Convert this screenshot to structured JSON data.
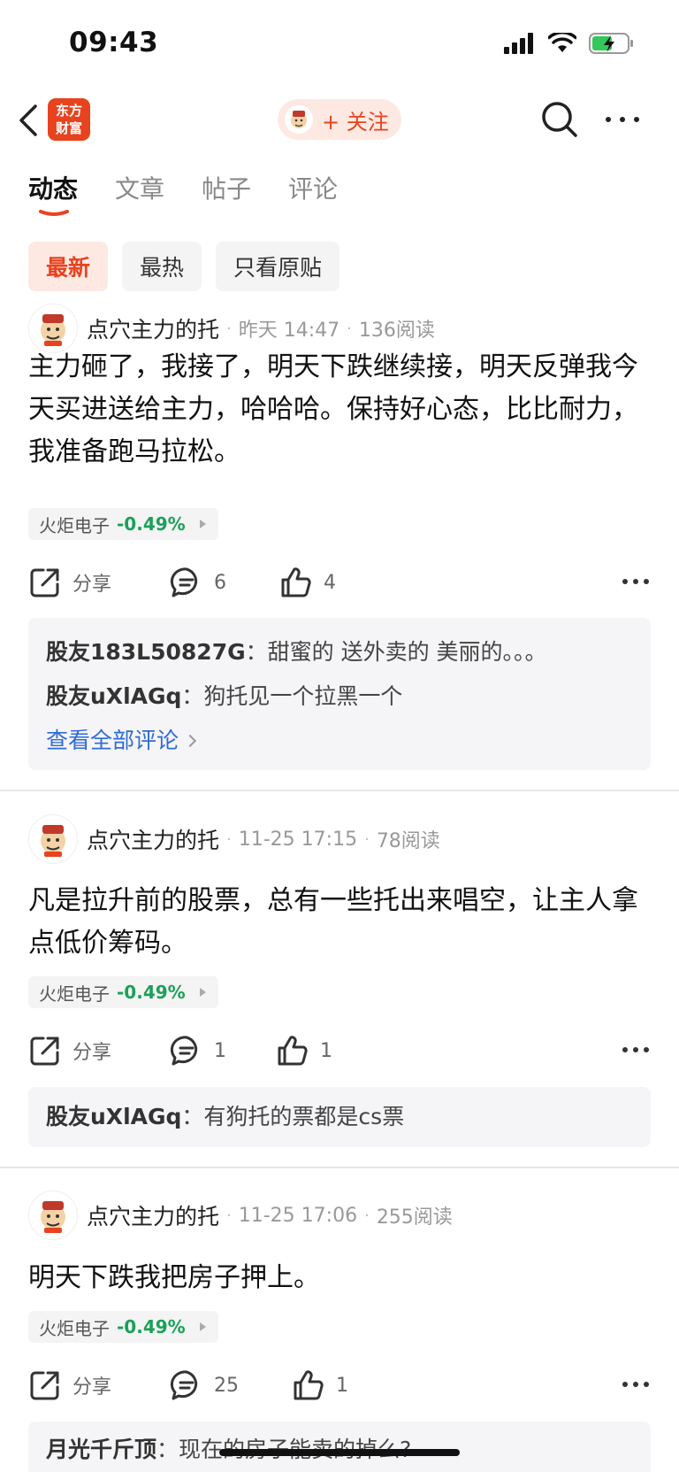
{
  "status_bar": {
    "time": "09:43"
  },
  "nav": {
    "logo_line1": "东方",
    "logo_line2": "财富",
    "follow_label": "+ 关注"
  },
  "tabs": [
    {
      "label": "动态",
      "active": true
    },
    {
      "label": "文章",
      "active": false
    },
    {
      "label": "帖子",
      "active": false
    },
    {
      "label": "评论",
      "active": false
    }
  ],
  "filters": [
    {
      "label": "最新",
      "active": true
    },
    {
      "label": "最热",
      "active": false
    },
    {
      "label": "只看原贴",
      "active": false
    }
  ],
  "posts": [
    {
      "author": "点穴主力的托",
      "time": "昨天 14:47",
      "reads": "136阅读",
      "body": "主力砸了，我接了，明天下跌继续接，明天反弹我今天买进送给主力，哈哈哈。保持好心态，比比耐力，我准备跑马拉松。",
      "stock_name": "火炬电子",
      "stock_change": "-0.49%",
      "share_label": "分享",
      "comment_count": "6",
      "like_count": "4",
      "comments": [
        {
          "user": "股友183L50827G",
          "sep": "：",
          "text": "甜蜜的 送外卖的 美丽的。。。"
        },
        {
          "user": "股友uXlAGq",
          "sep": "：",
          "text": "狗托见一个拉黑一个"
        }
      ],
      "view_all": "查看全部评论"
    },
    {
      "author": "点穴主力的托",
      "time": "11-25 17:15",
      "reads": "78阅读",
      "body": "凡是拉升前的股票，总有一些托出来唱空，让主人拿点低价筹码。",
      "stock_name": "火炬电子",
      "stock_change": "-0.49%",
      "share_label": "分享",
      "comment_count": "1",
      "like_count": "1",
      "comments": [
        {
          "user": "股友uXlAGq",
          "sep": "：",
          "text": "有狗托的票都是cs票"
        }
      ]
    },
    {
      "author": "点穴主力的托",
      "time": "11-25 17:06",
      "reads": "255阅读",
      "body": "明天下跌我把房子押上。",
      "stock_name": "火炬电子",
      "stock_change": "-0.49%",
      "share_label": "分享",
      "comment_count": "25",
      "like_count": "1",
      "comments": [
        {
          "user": "月光千斤顶",
          "sep": "：",
          "text": "现在的房子能卖的掉么?"
        }
      ]
    }
  ],
  "colors": {
    "accent": "#e8431f",
    "accent_bg": "#fde9e2",
    "down_green": "#1ba05a",
    "link_blue": "#2f6bd6"
  }
}
